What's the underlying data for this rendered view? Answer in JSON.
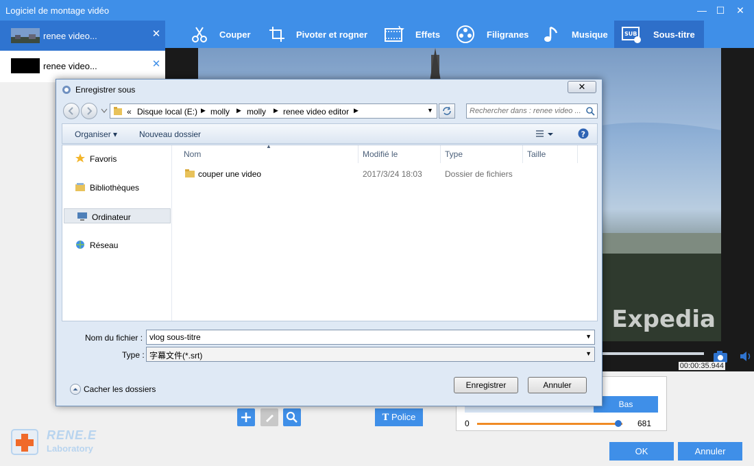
{
  "app": {
    "title": "Logiciel de montage vidéo",
    "window_buttons": [
      "—",
      "☐",
      "✕"
    ]
  },
  "clips": [
    {
      "label": "renee video...",
      "close": "✕",
      "active": true
    },
    {
      "label": "renee video...",
      "close": "✕",
      "active": false
    }
  ],
  "toolbar": {
    "items": [
      {
        "label": "Couper",
        "icon": "scissors-icon"
      },
      {
        "label": "Pivoter et rogner",
        "icon": "crop-rotate-icon"
      },
      {
        "label": "Effets",
        "icon": "effects-film-icon"
      },
      {
        "label": "Filigranes",
        "icon": "watermark-reel-icon"
      },
      {
        "label": "Musique",
        "icon": "music-note-icon"
      },
      {
        "label": "Sous-titre",
        "icon": "subtitle-icon",
        "active": true
      }
    ]
  },
  "preview": {
    "watermark": "Expedia",
    "timecode": "00:00:35.944"
  },
  "subtitle_panel": {
    "police_label": "Police",
    "position_selected": "Bas",
    "slider_min": "0",
    "slider_max": "681",
    "slider_value_fraction": 0.97
  },
  "footer": {
    "ok_label": "OK",
    "cancel_label": "Annuler",
    "logo_line1": "RENE.E",
    "logo_line2": "Laboratory"
  },
  "dialog": {
    "title": "Enregistrer sous",
    "close": "✕",
    "address": {
      "prefix": "«",
      "segments": [
        "Disque local (E:)",
        "molly",
        "molly",
        "renee video editor"
      ]
    },
    "search_placeholder": "Rechercher dans : renee video ...",
    "commands": {
      "organize": "Organiser ▾",
      "new_folder": "Nouveau dossier"
    },
    "nav_items": [
      {
        "label": "Favoris",
        "icon": "star-icon"
      },
      {
        "label": "Bibliothèques",
        "icon": "library-icon"
      },
      {
        "label": "Ordinateur",
        "icon": "computer-icon",
        "selected": true
      },
      {
        "label": "Réseau",
        "icon": "network-icon"
      }
    ],
    "columns": [
      "Nom",
      "Modifié le",
      "Type",
      "Taille"
    ],
    "rows": [
      {
        "name": "couper une video",
        "modified": "2017/3/24 18:03",
        "type": "Dossier de fichiers",
        "size": ""
      }
    ],
    "filename_label": "Nom du fichier :",
    "filename_value": "vlog sous-titre",
    "type_label": "Type :",
    "type_value": "字幕文件(*.srt)",
    "hide_folders": "Cacher les dossiers",
    "save_label": "Enregistrer",
    "cancel_label": "Annuler"
  },
  "colors": {
    "accent": "#3f8fe8",
    "accent_dark": "#2f74d0",
    "slider": "#f08a24"
  }
}
